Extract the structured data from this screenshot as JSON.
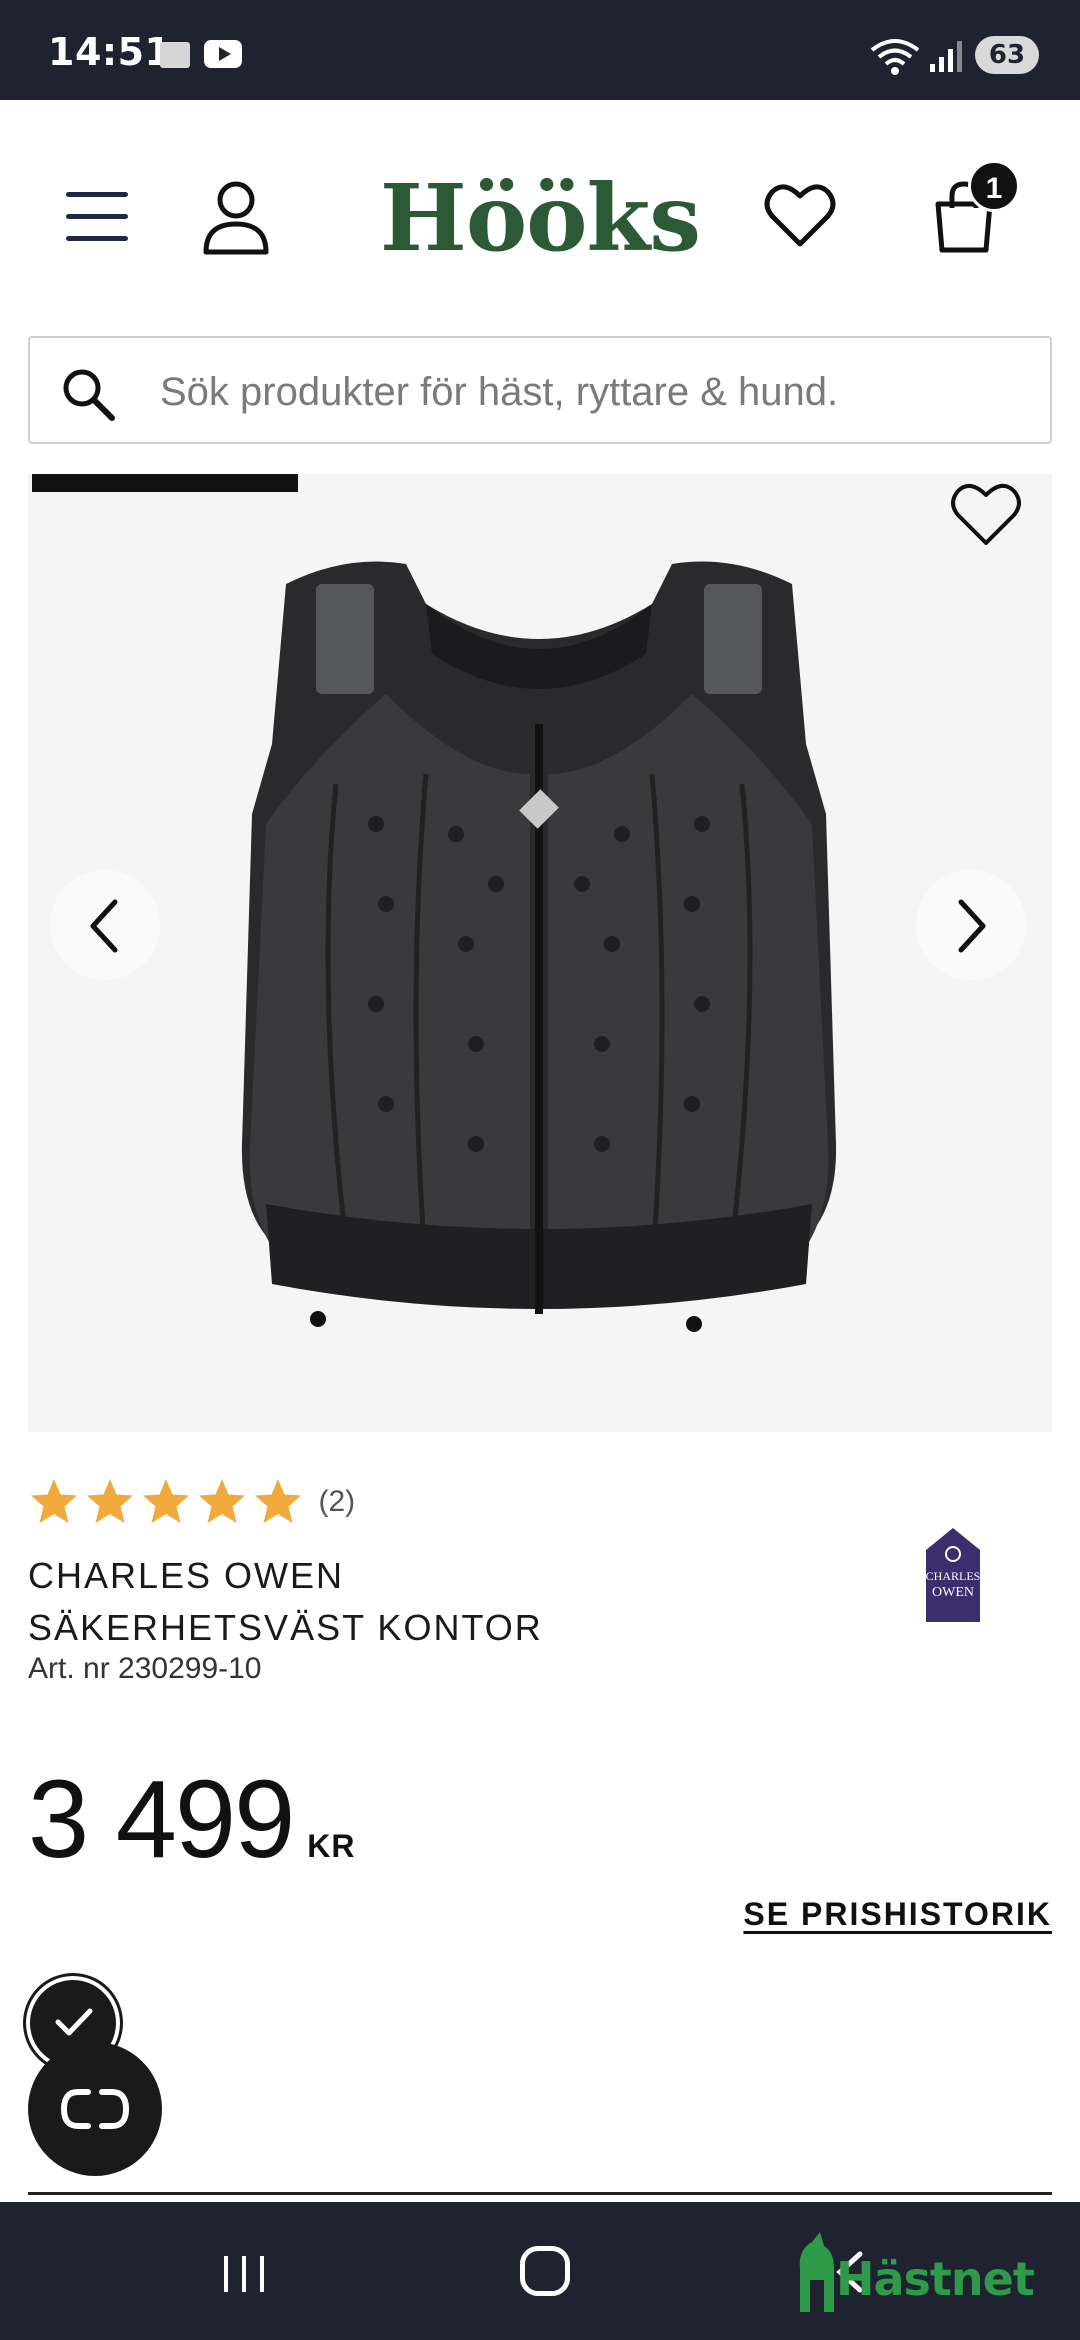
{
  "status_bar": {
    "time": "14:51",
    "battery": "63"
  },
  "header": {
    "logo": "Hööks",
    "cart_count": "1"
  },
  "search": {
    "placeholder": "Sök produkter för häst, ryttare & hund."
  },
  "gallery": {
    "progress": 0.26
  },
  "product": {
    "rating_stars": 5,
    "rating_count": "(2)",
    "name_line1": "CHARLES OWEN",
    "name_line2": "SÄKERHETSVÄST KONTOR",
    "art_nr": "Art. nr 230299-10",
    "price": "3 499",
    "currency": "KR",
    "price_history_label": "SE PRISHISTORIK",
    "brand_logo_text": "CHARLES OWEN"
  },
  "watermark": {
    "text": "Hästnet"
  },
  "colors": {
    "brand_green": "#2d5a36",
    "star_gold": "#f2a93b",
    "bars_dark": "#1f2330",
    "hastnet_green": "#2f9a4a"
  }
}
